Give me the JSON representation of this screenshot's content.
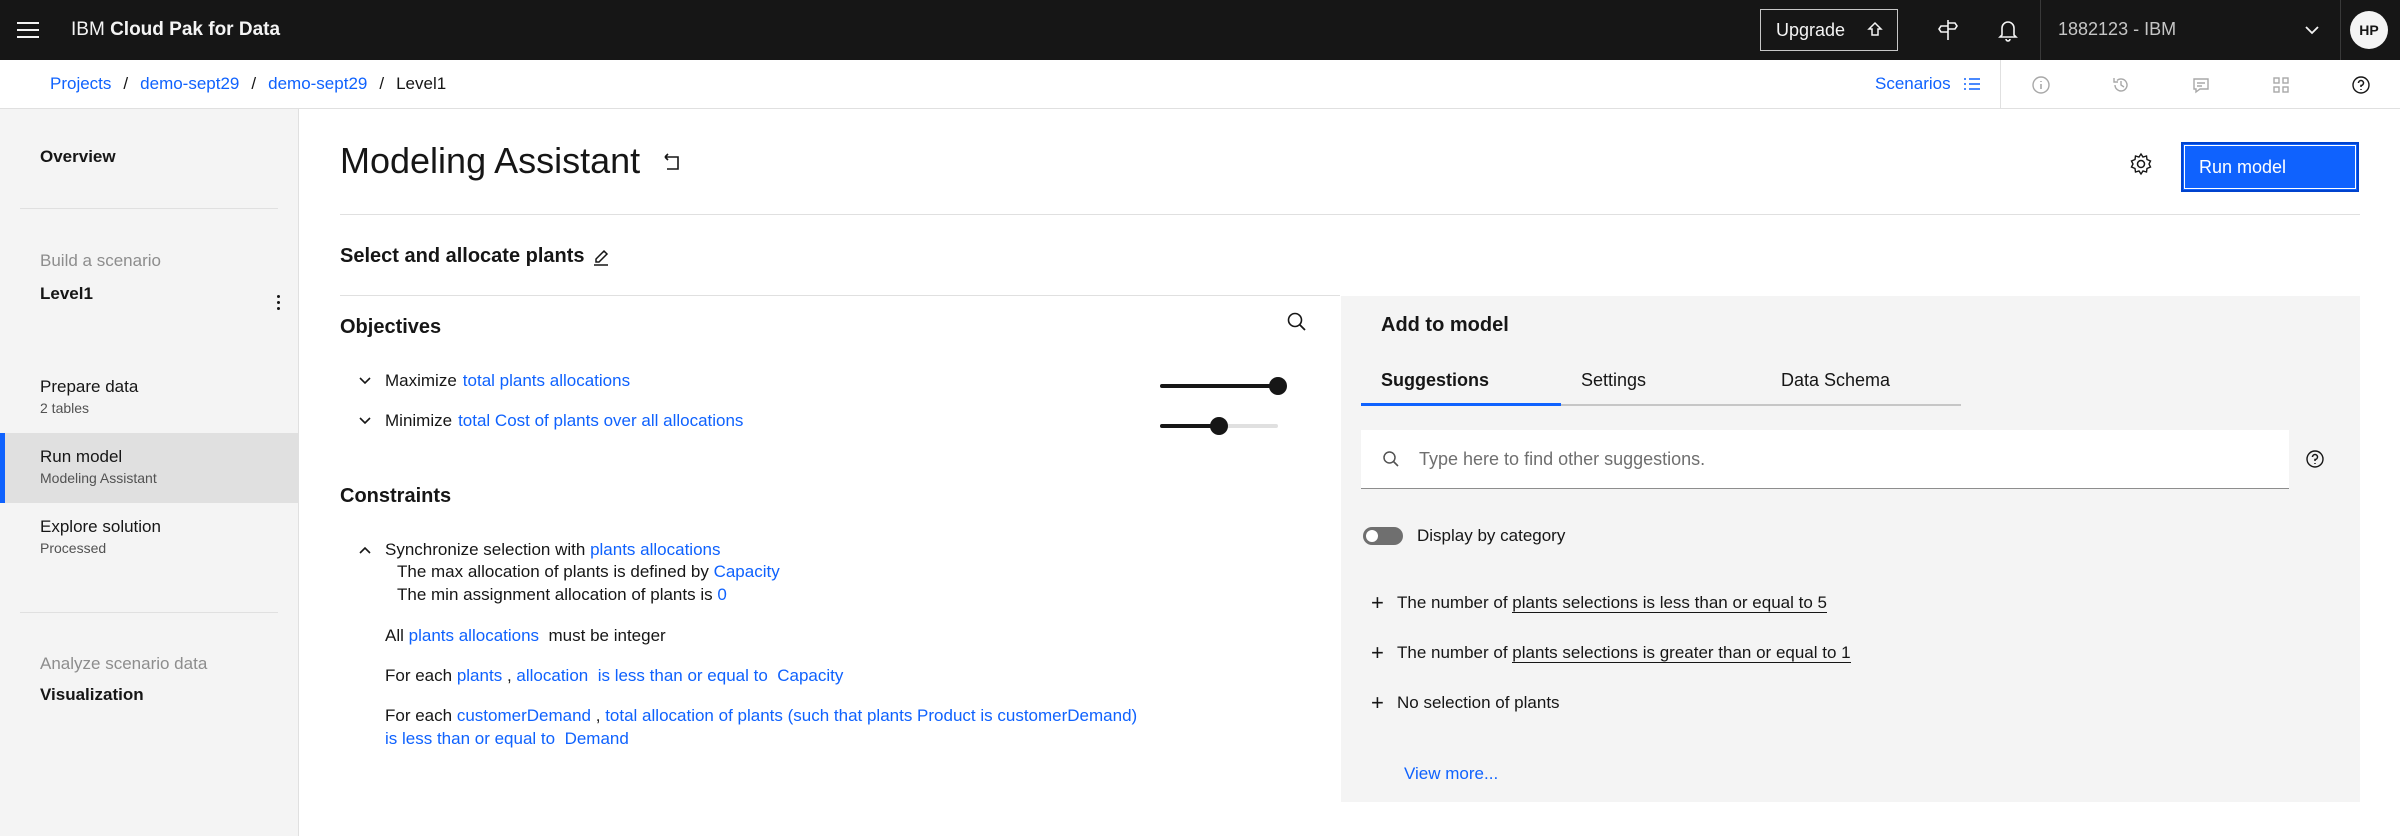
{
  "header": {
    "brand_prefix": "IBM",
    "brand_name": "Cloud Pak for Data",
    "upgrade_label": "Upgrade",
    "account": "1882123 - IBM",
    "avatar_initials": "HP"
  },
  "breadcrumb": {
    "items": [
      "Projects",
      "demo-sept29",
      "demo-sept29"
    ],
    "current": "Level1",
    "scenarios_label": "Scenarios"
  },
  "sidebar": {
    "overview": "Overview",
    "build_label": "Build a scenario",
    "scenario_name": "Level1",
    "prepare_title": "Prepare data",
    "prepare_sub": "2 tables",
    "run_title": "Run model",
    "run_sub": "Modeling Assistant",
    "explore_title": "Explore solution",
    "explore_sub": "Processed",
    "analyze_label": "Analyze scenario data",
    "visualization": "Visualization"
  },
  "main": {
    "title": "Modeling Assistant",
    "run_button": "Run model",
    "model_name": "Select and allocate plants",
    "objectives_heading": "Objectives",
    "objectives": [
      {
        "verb": "Maximize",
        "target": "total plants allocations",
        "weight": 1.0
      },
      {
        "verb": "Minimize",
        "target": "total Cost of plants over all allocations",
        "weight": 0.5
      }
    ],
    "constraints_heading": "Constraints",
    "constraints": {
      "c1_prefix": "Synchronize selection with",
      "c1_link": "plants allocations",
      "c1a_prefix": "The max allocation of plants is defined by",
      "c1a_link": "Capacity",
      "c1b_prefix": "The min assignment allocation of plants is",
      "c1b_link": "0",
      "c2_prefix": "All",
      "c2_link": "plants allocations",
      "c2_suffix": "must be integer",
      "c3_prefix": "For each",
      "c3_link1": "plants",
      "c3_sep": ",",
      "c3_link2": "allocation",
      "c3_link3": "is less than or equal to",
      "c3_link4": "Capacity",
      "c4_prefix": "For each",
      "c4_link1": "customerDemand",
      "c4_sep": ",",
      "c4_link2": "total allocation of plants (such that plants Product is customerDemand)",
      "c4_link3": "is less than or equal to",
      "c4_link4": "Demand"
    }
  },
  "add_panel": {
    "title": "Add to model",
    "tabs": [
      "Suggestions",
      "Settings",
      "Data Schema"
    ],
    "search_placeholder": "Type here to find other suggestions.",
    "toggle_label": "Display by category",
    "suggestions": [
      {
        "prefix": "The number of",
        "link": "plants selections is less than or equal to 5"
      },
      {
        "prefix": "The number of",
        "link": "plants selections is greater than or equal to 1"
      },
      {
        "prefix": "",
        "link": "No selection of plants"
      }
    ],
    "view_more": "View more..."
  },
  "colors": {
    "accent": "#0f62fe",
    "header_bg": "#161616",
    "panel_bg": "#f4f4f4"
  }
}
